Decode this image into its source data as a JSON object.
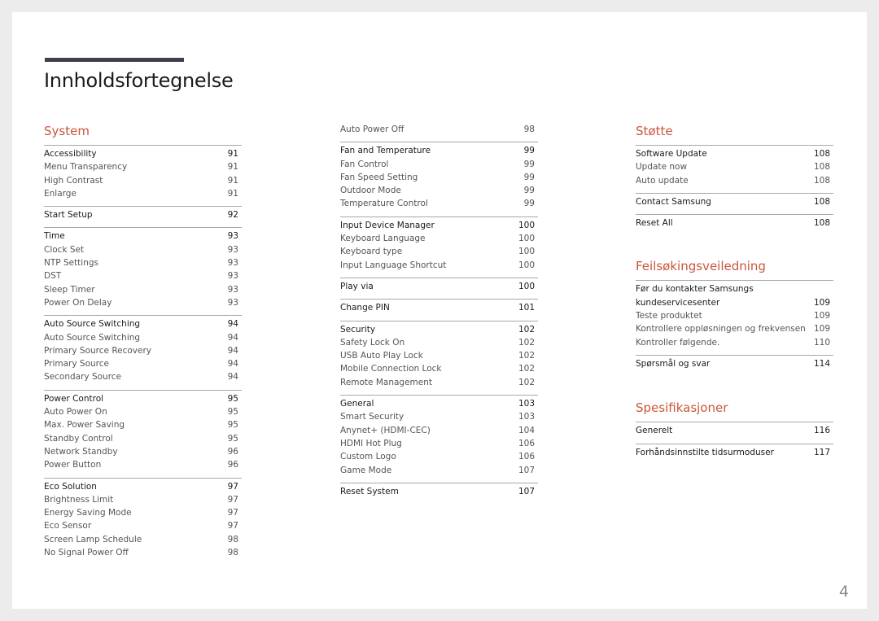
{
  "title": "Innholdsfortegnelse",
  "page_number": "4",
  "colors": {
    "accent": "#c8573b",
    "title_bar": "#3f3f4f",
    "background": "#ececec"
  },
  "sections": {
    "system": {
      "heading": "System",
      "groups": [
        {
          "head": {
            "label": "Accessibility",
            "page": "91"
          },
          "items": [
            {
              "label": "Menu Transparency",
              "page": "91"
            },
            {
              "label": "High Contrast",
              "page": "91"
            },
            {
              "label": "Enlarge",
              "page": "91"
            }
          ]
        },
        {
          "head": {
            "label": "Start Setup",
            "page": "92"
          },
          "items": []
        },
        {
          "head": {
            "label": "Time",
            "page": "93"
          },
          "items": [
            {
              "label": "Clock Set",
              "page": "93"
            },
            {
              "label": "NTP Settings",
              "page": "93"
            },
            {
              "label": "DST",
              "page": "93"
            },
            {
              "label": "Sleep Timer",
              "page": "93"
            },
            {
              "label": "Power On Delay",
              "page": "93"
            }
          ]
        },
        {
          "head": {
            "label": "Auto Source Switching",
            "page": "94"
          },
          "items": [
            {
              "label": "Auto Source Switching",
              "page": "94"
            },
            {
              "label": "Primary Source Recovery",
              "page": "94"
            },
            {
              "label": "Primary Source",
              "page": "94"
            },
            {
              "label": "Secondary Source",
              "page": "94"
            }
          ]
        },
        {
          "head": {
            "label": "Power Control",
            "page": "95"
          },
          "items": [
            {
              "label": "Auto Power On",
              "page": "95"
            },
            {
              "label": "Max. Power Saving",
              "page": "95"
            },
            {
              "label": "Standby Control",
              "page": "95"
            },
            {
              "label": "Network Standby",
              "page": "96"
            },
            {
              "label": "Power Button",
              "page": "96"
            }
          ]
        },
        {
          "head": {
            "label": "Eco Solution",
            "page": "97"
          },
          "items": [
            {
              "label": "Brightness Limit",
              "page": "97"
            },
            {
              "label": "Energy Saving Mode",
              "page": "97"
            },
            {
              "label": "Eco Sensor",
              "page": "97"
            },
            {
              "label": "Screen Lamp Schedule",
              "page": "98"
            },
            {
              "label": "No Signal Power Off",
              "page": "98"
            }
          ]
        }
      ]
    },
    "system_cont": {
      "groups": [
        {
          "items": [
            {
              "label": "Auto Power Off",
              "page": "98"
            }
          ]
        },
        {
          "head": {
            "label": "Fan and Temperature",
            "page": "99"
          },
          "items": [
            {
              "label": "Fan Control",
              "page": "99"
            },
            {
              "label": "Fan Speed Setting",
              "page": "99"
            },
            {
              "label": "Outdoor Mode",
              "page": "99"
            },
            {
              "label": "Temperature Control",
              "page": "99"
            }
          ]
        },
        {
          "head": {
            "label": "Input Device Manager",
            "page": "100"
          },
          "items": [
            {
              "label": "Keyboard Language",
              "page": "100"
            },
            {
              "label": "Keyboard type",
              "page": "100"
            },
            {
              "label": "Input Language Shortcut",
              "page": "100"
            }
          ]
        },
        {
          "head": {
            "label": "Play via",
            "page": "100"
          },
          "items": []
        },
        {
          "head": {
            "label": "Change PIN",
            "page": "101"
          },
          "items": []
        },
        {
          "head": {
            "label": "Security",
            "page": "102"
          },
          "items": [
            {
              "label": "Safety Lock On",
              "page": "102"
            },
            {
              "label": "USB Auto Play Lock",
              "page": "102"
            },
            {
              "label": "Mobile Connection Lock",
              "page": "102"
            },
            {
              "label": "Remote Management",
              "page": "102"
            }
          ]
        },
        {
          "head": {
            "label": "General",
            "page": "103"
          },
          "items": [
            {
              "label": "Smart Security",
              "page": "103"
            },
            {
              "label": "Anynet+ (HDMI-CEC)",
              "page": "104"
            },
            {
              "label": "HDMI Hot Plug",
              "page": "106"
            },
            {
              "label": "Custom Logo",
              "page": "106"
            },
            {
              "label": "Game Mode",
              "page": "107"
            }
          ]
        },
        {
          "head": {
            "label": "Reset System",
            "page": "107"
          },
          "items": []
        }
      ]
    },
    "support": {
      "heading": "Støtte",
      "groups": [
        {
          "head": {
            "label": "Software Update",
            "page": "108"
          },
          "items": [
            {
              "label": "Update now",
              "page": "108"
            },
            {
              "label": "Auto update",
              "page": "108"
            }
          ]
        },
        {
          "head": {
            "label": "Contact Samsung",
            "page": "108"
          },
          "items": []
        },
        {
          "head": {
            "label": "Reset All",
            "page": "108"
          },
          "items": []
        }
      ]
    },
    "troubleshooting": {
      "heading": "Feilsøkingsveiledning",
      "groups": [
        {
          "head": {
            "label_line1": "Før du kontakter Samsungs",
            "label_line2": "kundeservicesenter",
            "page": "109"
          },
          "items": [
            {
              "label": "Teste produktet",
              "page": "109"
            },
            {
              "label": "Kontrollere oppløsningen og frekvensen",
              "page": "109"
            },
            {
              "label": "Kontroller følgende.",
              "page": "110"
            }
          ]
        },
        {
          "head": {
            "label": "Spørsmål og svar",
            "page": "114"
          },
          "items": []
        }
      ]
    },
    "specifications": {
      "heading": "Spesifikasjoner",
      "groups": [
        {
          "head": {
            "label": "Generelt",
            "page": "116"
          },
          "items": []
        },
        {
          "head": {
            "label": "Forhåndsinnstilte tidsurmoduser",
            "page": "117"
          },
          "items": []
        }
      ]
    }
  }
}
